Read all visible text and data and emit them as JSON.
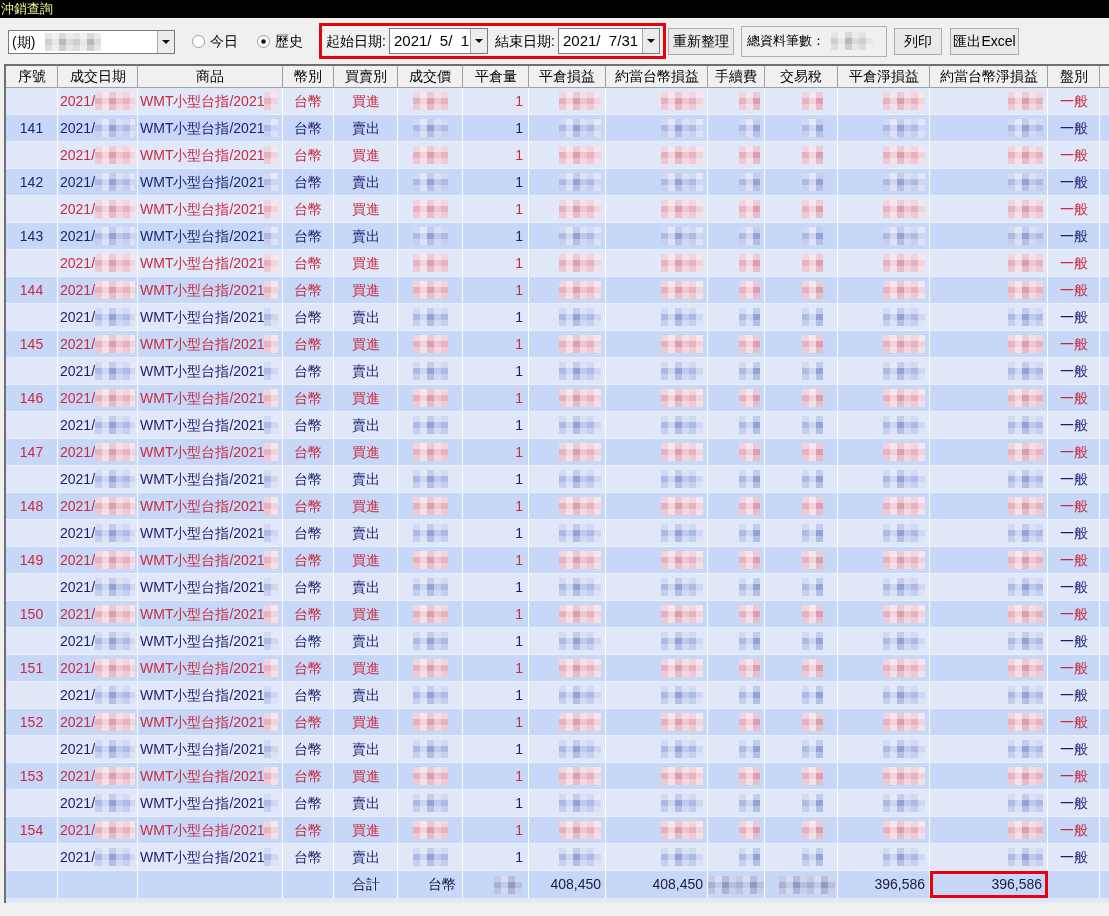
{
  "window": {
    "title": "沖銷查詢"
  },
  "toolbar": {
    "period_select": {
      "value": "(期)"
    },
    "radios": [
      {
        "label": "今日",
        "selected": false
      },
      {
        "label": "歷史",
        "selected": true
      }
    ],
    "date_range": {
      "highlighted": true,
      "start": {
        "label": "起始日期:",
        "value": "2021/  5/  1"
      },
      "end": {
        "label": "結束日期:",
        "value": "2021/  7/31"
      }
    },
    "refresh_button": "重新整理",
    "record_count": {
      "label": "總資料筆數："
    },
    "buttons": [
      "列印",
      "匯出Excel"
    ]
  },
  "table": {
    "columns": [
      "序號",
      "成交日期",
      "商品",
      "幣別",
      "買賣別",
      "成交價",
      "平倉量",
      "平倉損益",
      "約當台幣損益",
      "手續費",
      "交易稅",
      "平倉淨損益",
      "約當台幣淨損益",
      "盤別"
    ],
    "rows": [
      {
        "date": "2021/",
        "product": "WMT小型台指/2021",
        "currency": "台幣",
        "side": "買進",
        "qty": "1",
        "session": "一般",
        "kind": "buy"
      },
      {
        "seq": "141",
        "date": "2021/",
        "product": "WMT小型台指/2021",
        "currency": "台幣",
        "side": "賣出",
        "qty": "1",
        "session": "一般",
        "kind": "sell"
      },
      {
        "date": "2021/",
        "product": "WMT小型台指/2021",
        "currency": "台幣",
        "side": "買進",
        "qty": "1",
        "session": "一般",
        "kind": "buy"
      },
      {
        "seq": "142",
        "date": "2021/",
        "product": "WMT小型台指/2021",
        "currency": "台幣",
        "side": "賣出",
        "qty": "1",
        "session": "一般",
        "kind": "sell"
      },
      {
        "date": "2021/",
        "product": "WMT小型台指/2021",
        "currency": "台幣",
        "side": "買進",
        "qty": "1",
        "session": "一般",
        "kind": "buy"
      },
      {
        "seq": "143",
        "date": "2021/",
        "product": "WMT小型台指/2021",
        "currency": "台幣",
        "side": "賣出",
        "qty": "1",
        "session": "一般",
        "kind": "sell"
      },
      {
        "date": "2021/",
        "product": "WMT小型台指/2021",
        "currency": "台幣",
        "side": "買進",
        "qty": "1",
        "session": "一般",
        "kind": "buy"
      },
      {
        "seq": "144",
        "date": "2021/",
        "product": "WMT小型台指/2021",
        "currency": "台幣",
        "side": "買進",
        "qty": "1",
        "session": "一般",
        "kind": "buy"
      },
      {
        "date": "2021/",
        "product": "WMT小型台指/2021",
        "currency": "台幣",
        "side": "賣出",
        "qty": "1",
        "session": "一般",
        "kind": "sell"
      },
      {
        "seq": "145",
        "date": "2021/",
        "product": "WMT小型台指/2021",
        "currency": "台幣",
        "side": "買進",
        "qty": "1",
        "session": "一般",
        "kind": "buy"
      },
      {
        "date": "2021/",
        "product": "WMT小型台指/2021",
        "currency": "台幣",
        "side": "賣出",
        "qty": "1",
        "session": "一般",
        "kind": "sell"
      },
      {
        "seq": "146",
        "date": "2021/",
        "product": "WMT小型台指/2021",
        "currency": "台幣",
        "side": "買進",
        "qty": "1",
        "session": "一般",
        "kind": "buy"
      },
      {
        "date": "2021/",
        "product": "WMT小型台指/2021",
        "currency": "台幣",
        "side": "賣出",
        "qty": "1",
        "session": "一般",
        "kind": "sell"
      },
      {
        "seq": "147",
        "date": "2021/",
        "product": "WMT小型台指/2021",
        "currency": "台幣",
        "side": "買進",
        "qty": "1",
        "session": "一般",
        "kind": "buy"
      },
      {
        "date": "2021/",
        "product": "WMT小型台指/2021",
        "currency": "台幣",
        "side": "賣出",
        "qty": "1",
        "session": "一般",
        "kind": "sell"
      },
      {
        "seq": "148",
        "date": "2021/",
        "product": "WMT小型台指/2021",
        "currency": "台幣",
        "side": "買進",
        "qty": "1",
        "session": "一般",
        "kind": "buy"
      },
      {
        "date": "2021/",
        "product": "WMT小型台指/2021",
        "currency": "台幣",
        "side": "賣出",
        "qty": "1",
        "session": "一般",
        "kind": "sell"
      },
      {
        "seq": "149",
        "date": "2021/",
        "product": "WMT小型台指/2021",
        "currency": "台幣",
        "side": "買進",
        "qty": "1",
        "session": "一般",
        "kind": "buy"
      },
      {
        "date": "2021/",
        "product": "WMT小型台指/2021",
        "currency": "台幣",
        "side": "賣出",
        "qty": "1",
        "session": "一般",
        "kind": "sell"
      },
      {
        "seq": "150",
        "date": "2021/",
        "product": "WMT小型台指/2021",
        "currency": "台幣",
        "side": "買進",
        "qty": "1",
        "session": "一般",
        "kind": "buy"
      },
      {
        "date": "2021/",
        "product": "WMT小型台指/2021",
        "currency": "台幣",
        "side": "賣出",
        "qty": "1",
        "session": "一般",
        "kind": "sell"
      },
      {
        "seq": "151",
        "date": "2021/",
        "product": "WMT小型台指/2021",
        "currency": "台幣",
        "side": "買進",
        "qty": "1",
        "session": "一般",
        "kind": "buy"
      },
      {
        "date": "2021/",
        "product": "WMT小型台指/2021",
        "currency": "台幣",
        "side": "賣出",
        "qty": "1",
        "session": "一般",
        "kind": "sell"
      },
      {
        "seq": "152",
        "date": "2021/",
        "product": "WMT小型台指/2021",
        "currency": "台幣",
        "side": "買進",
        "qty": "1",
        "session": "一般",
        "kind": "buy"
      },
      {
        "date": "2021/",
        "product": "WMT小型台指/2021",
        "currency": "台幣",
        "side": "賣出",
        "qty": "1",
        "session": "一般",
        "kind": "sell"
      },
      {
        "seq": "153",
        "date": "2021/",
        "product": "WMT小型台指/2021",
        "currency": "台幣",
        "side": "買進",
        "qty": "1",
        "session": "一般",
        "kind": "buy"
      },
      {
        "date": "2021/",
        "product": "WMT小型台指/2021",
        "currency": "台幣",
        "side": "賣出",
        "qty": "1",
        "session": "一般",
        "kind": "sell"
      },
      {
        "seq": "154",
        "date": "2021/",
        "product": "WMT小型台指/2021",
        "currency": "台幣",
        "side": "買進",
        "qty": "1",
        "session": "一般",
        "kind": "buy"
      },
      {
        "date": "2021/",
        "product": "WMT小型台指/2021",
        "currency": "台幣",
        "side": "賣出",
        "qty": "1",
        "session": "一般",
        "kind": "sell"
      }
    ],
    "totals": {
      "label": "合計",
      "currency": "台幣",
      "close_pnl": "408,450",
      "twd_pnl": "408,450",
      "net_pnl": "396,586",
      "twd_net_pnl": {
        "value": "396,586",
        "highlighted": true
      }
    }
  }
}
